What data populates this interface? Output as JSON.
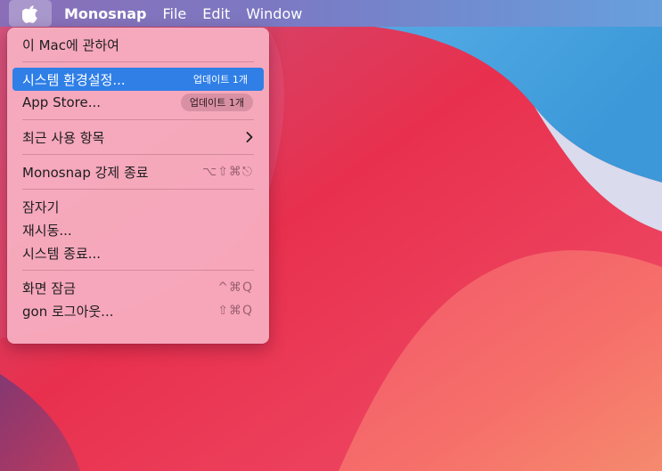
{
  "menubar": {
    "app_name": "Monosnap",
    "items": [
      "File",
      "Edit",
      "Window"
    ]
  },
  "apple_menu": {
    "about": "이 Mac에 관하여",
    "system_prefs": "시스템 환경설정...",
    "system_prefs_badge": "업데이트 1개",
    "app_store": "App Store...",
    "app_store_badge": "업데이트 1개",
    "recent_items": "최근 사용 항목",
    "force_quit": "Monosnap 강제 종료",
    "force_quit_shortcut": "⌥⇧⌘⎋",
    "sleep": "잠자기",
    "restart": "재시동...",
    "shutdown": "시스템 종료...",
    "lock_screen": "화면 잠금",
    "lock_screen_shortcut": "^⌘Q",
    "logout": "gon 로그아웃...",
    "logout_shortcut": "⇧⌘Q"
  },
  "colors": {
    "highlight": "#2f7fe7",
    "wallpaper_red": "#e23a54",
    "wallpaper_blue": "#4a9fdc"
  },
  "icons": {
    "apple": "apple-logo-icon",
    "chevron": "chevron-right-icon"
  }
}
